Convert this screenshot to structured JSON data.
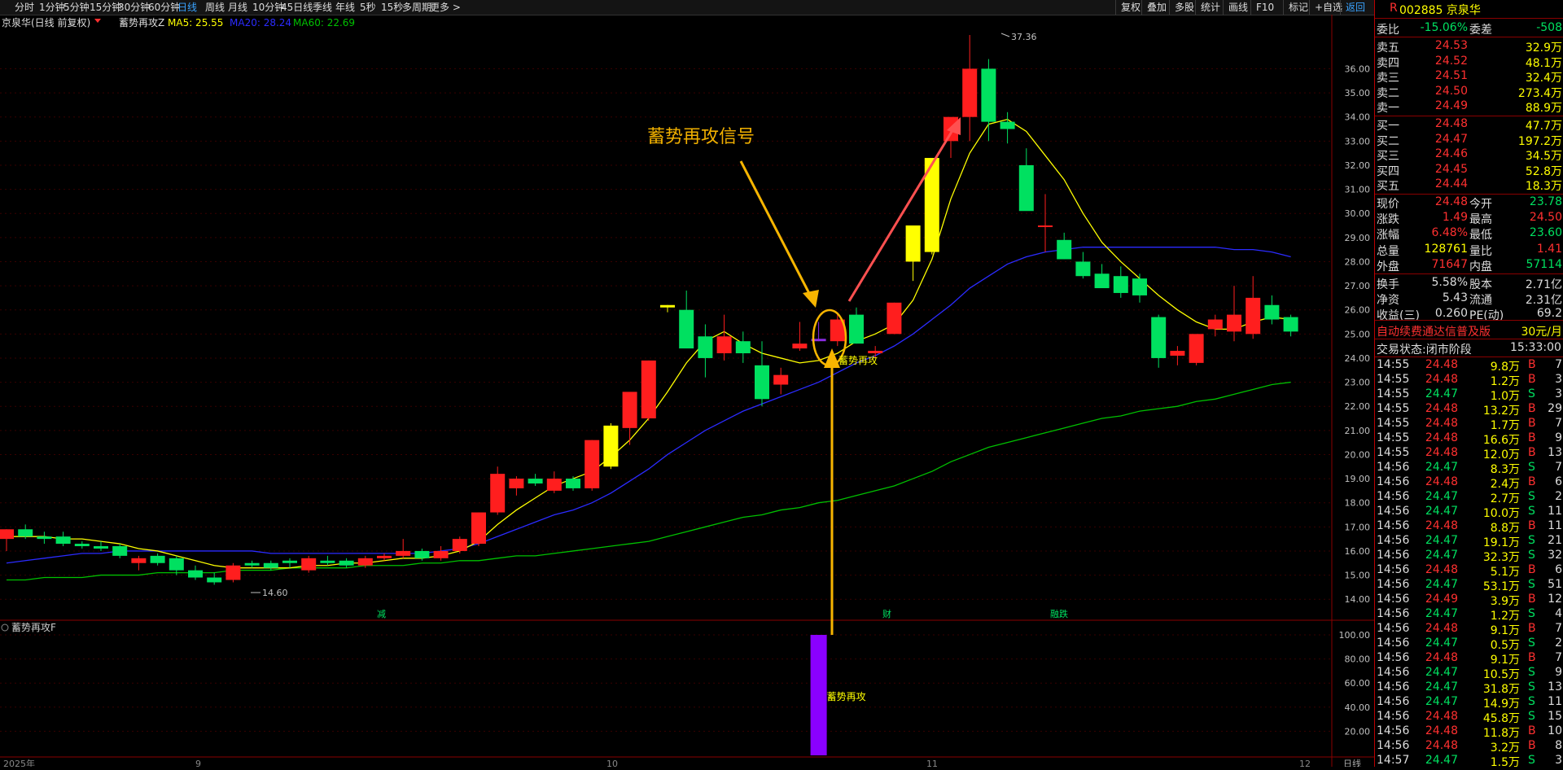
{
  "toolbar": {
    "left": [
      "分时",
      "1分钟",
      "5分钟",
      "15分钟",
      "30分钟",
      "60分钟",
      "日线",
      "周线",
      "月线",
      "10分钟",
      "45日线",
      "季线",
      "年线",
      "5秒",
      "15秒",
      "多周期",
      "更多 >"
    ],
    "active": "日线",
    "right": [
      "复权",
      "叠加",
      "多股",
      "统计",
      "画线",
      "F10",
      "标记",
      "+自选",
      "返回"
    ]
  },
  "legend": {
    "stock": "京泉华(日线 前复权)",
    "indicator": "蓄势再攻Z",
    "ma5": "MA5: 25.55",
    "ma20": "MA20: 28.24",
    "ma60": "MA60: 22.69",
    "ma5_color": "#ffff00",
    "ma20_color": "#2b2bff",
    "ma60_color": "#00c000"
  },
  "annotations": {
    "callout": "蓄势再攻信号",
    "marker_label": "蓄势再攻",
    "high_label": "37.36",
    "low_label": "14.60",
    "event_markers": [
      "减",
      "财",
      "融跌"
    ]
  },
  "sub_panel": {
    "title": "蓄势再攻F",
    "bar_label": "蓄势再攻",
    "y_ticks": [
      "100.00",
      "80.00",
      "60.00",
      "40.00",
      "20.00"
    ]
  },
  "axis": {
    "y_ticks": [
      "36.00",
      "35.00",
      "34.00",
      "33.00",
      "32.00",
      "31.00",
      "30.00",
      "29.00",
      "28.00",
      "27.00",
      "26.00",
      "25.00",
      "24.00",
      "23.00",
      "22.00",
      "21.00",
      "20.00",
      "19.00",
      "18.00",
      "17.00",
      "16.00",
      "15.00",
      "14.00"
    ],
    "x_labels": [
      "2025年",
      "9",
      "10",
      "11",
      "12"
    ],
    "x_unit": "日线"
  },
  "chart_data": {
    "type": "candlestick",
    "ylim": [
      13.5,
      37.5
    ],
    "ohlc": [
      [
        16.5,
        16.9,
        16.0,
        16.9
      ],
      [
        16.9,
        17.1,
        16.5,
        16.6
      ],
      [
        16.6,
        16.8,
        16.3,
        16.5
      ],
      [
        16.6,
        16.8,
        16.2,
        16.3
      ],
      [
        16.3,
        16.4,
        16.1,
        16.2
      ],
      [
        16.2,
        16.4,
        16.0,
        16.1
      ],
      [
        16.2,
        16.3,
        15.7,
        15.8
      ],
      [
        15.5,
        15.8,
        15.2,
        15.7
      ],
      [
        15.8,
        15.9,
        15.4,
        15.5
      ],
      [
        15.7,
        15.8,
        15.0,
        15.2
      ],
      [
        15.2,
        15.4,
        14.8,
        14.9
      ],
      [
        14.9,
        15.1,
        14.6,
        14.7
      ],
      [
        14.8,
        15.5,
        14.7,
        15.4
      ],
      [
        15.5,
        15.6,
        15.3,
        15.4
      ],
      [
        15.5,
        15.6,
        15.2,
        15.3
      ],
      [
        15.6,
        15.7,
        15.3,
        15.5
      ],
      [
        15.2,
        15.8,
        15.1,
        15.7
      ],
      [
        15.6,
        15.8,
        15.4,
        15.5
      ],
      [
        15.6,
        15.7,
        15.3,
        15.4
      ],
      [
        15.4,
        15.8,
        15.3,
        15.7
      ],
      [
        15.7,
        15.9,
        15.6,
        15.8
      ],
      [
        15.8,
        16.5,
        15.7,
        16.0
      ],
      [
        16.0,
        16.1,
        15.6,
        15.7
      ],
      [
        15.7,
        16.2,
        15.6,
        16.0
      ],
      [
        16.0,
        16.6,
        15.9,
        16.5
      ],
      [
        16.3,
        17.6,
        16.2,
        17.6
      ],
      [
        17.6,
        19.5,
        17.5,
        19.2
      ],
      [
        18.6,
        19.1,
        18.3,
        19.0
      ],
      [
        19.0,
        19.2,
        18.7,
        18.8
      ],
      [
        18.5,
        19.3,
        18.4,
        19.0
      ],
      [
        19.0,
        19.1,
        18.5,
        18.6
      ],
      [
        18.6,
        20.6,
        18.5,
        20.6
      ],
      [
        19.5,
        21.3,
        19.4,
        21.2
      ],
      [
        21.1,
        22.5,
        20.4,
        22.6
      ],
      [
        21.5,
        23.9,
        21.4,
        23.9
      ],
      [
        26.1,
        26.2,
        25.9,
        26.2
      ],
      [
        26.0,
        26.8,
        24.6,
        24.4
      ],
      [
        24.9,
        25.4,
        23.2,
        24.0
      ],
      [
        24.2,
        25.8,
        23.9,
        24.9
      ],
      [
        24.7,
        25.1,
        23.8,
        24.2
      ],
      [
        23.7,
        24.7,
        22.0,
        22.3
      ],
      [
        22.9,
        23.6,
        22.5,
        23.3
      ],
      [
        24.4,
        25.5,
        24.3,
        24.6
      ],
      [
        24.8,
        25.5,
        24.7,
        24.7
      ],
      [
        24.7,
        25.9,
        24.5,
        25.6
      ],
      [
        25.8,
        26.1,
        24.6,
        24.6
      ],
      [
        24.2,
        24.5,
        24.0,
        24.3
      ],
      [
        25.0,
        26.3,
        25.0,
        26.3
      ],
      [
        28.0,
        29.5,
        27.2,
        29.5
      ],
      [
        28.4,
        32.0,
        28.3,
        32.3
      ],
      [
        33.0,
        33.6,
        32.3,
        34.0
      ],
      [
        34.0,
        37.4,
        33.0,
        36.0
      ],
      [
        36.0,
        36.4,
        33.0,
        33.8
      ],
      [
        33.8,
        34.2,
        32.9,
        33.5
      ],
      [
        32.0,
        32.7,
        30.3,
        30.1
      ],
      [
        29.5,
        30.8,
        28.4,
        29.5
      ],
      [
        28.9,
        29.2,
        28.1,
        28.1
      ],
      [
        28.0,
        28.4,
        27.3,
        27.4
      ],
      [
        27.5,
        27.9,
        27.0,
        26.9
      ],
      [
        27.4,
        27.8,
        26.5,
        26.7
      ],
      [
        27.3,
        27.5,
        26.3,
        26.6
      ],
      [
        25.7,
        25.8,
        23.6,
        24.0
      ],
      [
        24.1,
        24.5,
        23.7,
        24.3
      ],
      [
        23.8,
        24.9,
        23.7,
        25.0
      ],
      [
        25.2,
        25.8,
        24.9,
        25.6
      ],
      [
        25.1,
        27.0,
        24.7,
        25.8
      ],
      [
        25.0,
        27.4,
        24.8,
        26.5
      ],
      [
        26.2,
        26.6,
        25.4,
        25.6
      ],
      [
        25.7,
        25.8,
        24.9,
        25.1
      ]
    ],
    "ma5": [
      16.6,
      16.6,
      16.6,
      16.5,
      16.5,
      16.4,
      16.3,
      16.1,
      16.0,
      15.8,
      15.6,
      15.4,
      15.3,
      15.3,
      15.3,
      15.3,
      15.4,
      15.4,
      15.5,
      15.5,
      15.6,
      15.7,
      15.7,
      15.8,
      16.0,
      16.4,
      17.1,
      17.7,
      18.2,
      18.7,
      19.0,
      19.3,
      19.9,
      20.6,
      21.5,
      22.6,
      23.8,
      24.7,
      25.1,
      24.6,
      24.2,
      24.0,
      23.8,
      23.9,
      24.2,
      24.7,
      25.0,
      25.4,
      26.4,
      28.1,
      30.6,
      32.5,
      33.7,
      33.9,
      33.4,
      32.4,
      31.4,
      30.0,
      28.8,
      28.0,
      27.3,
      26.6,
      26.0,
      25.5,
      25.2,
      25.2,
      25.5,
      25.7,
      25.6
    ],
    "ma20": [
      15.5,
      15.6,
      15.7,
      15.8,
      15.9,
      15.9,
      16.0,
      16.0,
      16.0,
      16.0,
      16.0,
      16.0,
      16.0,
      16.0,
      15.9,
      15.9,
      15.9,
      15.9,
      15.9,
      15.9,
      15.9,
      15.9,
      15.9,
      16.0,
      16.1,
      16.3,
      16.6,
      16.9,
      17.2,
      17.5,
      17.7,
      18.0,
      18.4,
      18.9,
      19.4,
      20.0,
      20.5,
      21.0,
      21.4,
      21.8,
      22.1,
      22.4,
      22.7,
      23.0,
      23.4,
      23.8,
      24.1,
      24.5,
      25.0,
      25.6,
      26.2,
      26.9,
      27.4,
      27.9,
      28.2,
      28.4,
      28.5,
      28.6,
      28.6,
      28.6,
      28.6,
      28.6,
      28.6,
      28.6,
      28.6,
      28.5,
      28.5,
      28.4,
      28.2
    ],
    "ma60": [
      14.8,
      14.8,
      14.9,
      14.9,
      14.9,
      15.0,
      15.0,
      15.0,
      15.1,
      15.1,
      15.1,
      15.1,
      15.2,
      15.2,
      15.2,
      15.3,
      15.3,
      15.3,
      15.3,
      15.4,
      15.4,
      15.4,
      15.5,
      15.5,
      15.6,
      15.6,
      15.7,
      15.8,
      15.8,
      15.9,
      16.0,
      16.1,
      16.2,
      16.3,
      16.4,
      16.6,
      16.8,
      17.0,
      17.2,
      17.4,
      17.5,
      17.7,
      17.8,
      18.0,
      18.1,
      18.3,
      18.5,
      18.7,
      19.0,
      19.3,
      19.7,
      20.0,
      20.3,
      20.5,
      20.7,
      20.9,
      21.1,
      21.3,
      21.5,
      21.6,
      21.8,
      21.9,
      22.0,
      22.2,
      22.3,
      22.5,
      22.7,
      22.9,
      23.0
    ],
    "signal_index": 43,
    "signal_value": 100,
    "yellow_indices": [
      32,
      35,
      48,
      49
    ],
    "purple_indices": [
      43
    ]
  },
  "quote": {
    "code": "002885",
    "name": "京泉华",
    "badge": "R",
    "weibi": {
      "l1": "委比",
      "v1": "-15.06%",
      "l2": "委差",
      "v2": "-508"
    },
    "asks": [
      {
        "l": "卖五",
        "p": "24.53",
        "v": "32.9万"
      },
      {
        "l": "卖四",
        "p": "24.52",
        "v": "48.1万"
      },
      {
        "l": "卖三",
        "p": "24.51",
        "v": "32.4万"
      },
      {
        "l": "卖二",
        "p": "24.50",
        "v": "273.4万"
      },
      {
        "l": "卖一",
        "p": "24.49",
        "v": "88.9万"
      }
    ],
    "bids": [
      {
        "l": "买一",
        "p": "24.48",
        "v": "47.7万"
      },
      {
        "l": "买二",
        "p": "24.47",
        "v": "197.2万"
      },
      {
        "l": "买三",
        "p": "24.46",
        "v": "34.5万"
      },
      {
        "l": "买四",
        "p": "24.45",
        "v": "52.8万"
      },
      {
        "l": "买五",
        "p": "24.44",
        "v": "18.3万"
      }
    ],
    "stats": [
      [
        "现价",
        "24.48",
        "今开",
        "23.78"
      ],
      [
        "涨跌",
        "1.49",
        "最高",
        "24.50"
      ],
      [
        "涨幅",
        "6.48%",
        "最低",
        "23.60"
      ],
      [
        "总量",
        "128761",
        "量比",
        "1.41"
      ],
      [
        "外盘",
        "71647",
        "内盘",
        "57114"
      ],
      [
        "换手",
        "5.58%",
        "股本",
        "2.71亿"
      ],
      [
        "净资",
        "5.43",
        "流通",
        "2.31亿"
      ],
      [
        "收益(三)",
        "0.260",
        "PE(动)",
        "69.2"
      ]
    ],
    "promo": {
      "text": "自动续费通达信普及版",
      "price": "30元/月"
    },
    "state": {
      "label": "交易状态:",
      "phase": "闭市阶段",
      "time": "15:33:00"
    },
    "ticks": [
      [
        "14:55",
        "24.48",
        "9.8万",
        "B",
        "7"
      ],
      [
        "14:55",
        "24.48",
        "1.2万",
        "B",
        "3"
      ],
      [
        "14:55",
        "24.47",
        "1.0万",
        "S",
        "3"
      ],
      [
        "14:55",
        "24.48",
        "13.2万",
        "B",
        "29"
      ],
      [
        "14:55",
        "24.48",
        "1.7万",
        "B",
        "7"
      ],
      [
        "14:55",
        "24.48",
        "16.6万",
        "B",
        "9"
      ],
      [
        "14:55",
        "24.48",
        "12.0万",
        "B",
        "13"
      ],
      [
        "14:56",
        "24.47",
        "8.3万",
        "S",
        "7"
      ],
      [
        "14:56",
        "24.48",
        "2.4万",
        "B",
        "6"
      ],
      [
        "14:56",
        "24.47",
        "2.7万",
        "S",
        "2"
      ],
      [
        "14:56",
        "24.47",
        "10.0万",
        "S",
        "11"
      ],
      [
        "14:56",
        "24.48",
        "8.8万",
        "B",
        "11"
      ],
      [
        "14:56",
        "24.47",
        "19.1万",
        "S",
        "21"
      ],
      [
        "14:56",
        "24.47",
        "32.3万",
        "S",
        "32"
      ],
      [
        "14:56",
        "24.48",
        "5.1万",
        "B",
        "6"
      ],
      [
        "14:56",
        "24.47",
        "53.1万",
        "S",
        "51"
      ],
      [
        "14:56",
        "24.49",
        "3.9万",
        "B",
        "12"
      ],
      [
        "14:56",
        "24.47",
        "1.2万",
        "S",
        "4"
      ],
      [
        "14:56",
        "24.48",
        "9.1万",
        "B",
        "7"
      ],
      [
        "14:56",
        "24.47",
        "0.5万",
        "S",
        "2"
      ],
      [
        "14:56",
        "24.48",
        "9.1万",
        "B",
        "7"
      ],
      [
        "14:56",
        "24.47",
        "10.5万",
        "S",
        "9"
      ],
      [
        "14:56",
        "24.47",
        "31.8万",
        "S",
        "13"
      ],
      [
        "14:56",
        "24.47",
        "14.9万",
        "S",
        "11"
      ],
      [
        "14:56",
        "24.48",
        "45.8万",
        "S",
        "15"
      ],
      [
        "14:56",
        "24.48",
        "11.8万",
        "B",
        "10"
      ],
      [
        "14:56",
        "24.48",
        "3.2万",
        "B",
        "8"
      ],
      [
        "14:57",
        "24.47",
        "1.5万",
        "S",
        "3"
      ]
    ]
  }
}
